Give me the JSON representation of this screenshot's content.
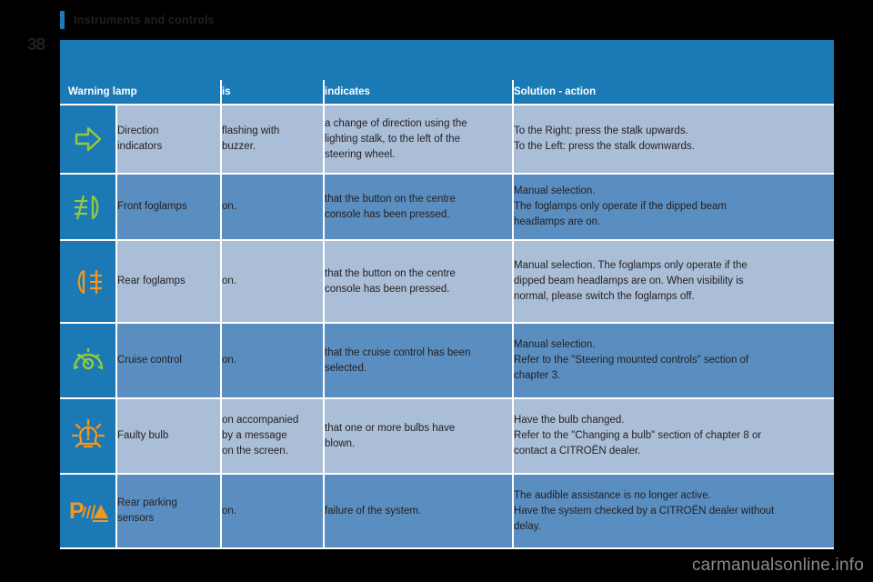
{
  "document": {
    "chapter_title": "Instruments and controls",
    "page_number": "38",
    "watermark": "carmanualsonline.info"
  },
  "colors": {
    "header_blue": "#1b7ab5",
    "row_light": "#aabed8",
    "row_dark": "#5a8dc0",
    "icon_green": "#95c93d",
    "icon_orange": "#f5961e",
    "text": "#231f20",
    "page_background": "#000000"
  },
  "table": {
    "headers": [
      "Warning lamp",
      "is",
      "indicates",
      "Solution - action"
    ],
    "rows": [
      {
        "icon": "direction-indicator-arrow-icon",
        "icon_color": "#95c93d",
        "lamp": [
          "Direction",
          "indicators"
        ],
        "is": [
          "flashing with",
          "buzzer."
        ],
        "indicates": [
          "a change of direction using the",
          "lighting stalk, to the left of the",
          "steering wheel."
        ],
        "solution": [
          "To the Right: press the stalk upwards.",
          "To the Left: press the stalk downwards."
        ],
        "shade": "light"
      },
      {
        "icon": "front-foglamp-icon",
        "icon_color": "#95c93d",
        "lamp": [
          "Front foglamps"
        ],
        "is": [
          "on."
        ],
        "indicates": [
          "that the button on the centre",
          "console has been pressed."
        ],
        "solution": [
          "Manual selection.",
          "The foglamps only operate if the dipped beam",
          "headlamps are on."
        ],
        "shade": "dark"
      },
      {
        "icon": "rear-foglamp-icon",
        "icon_color": "#f5961e",
        "lamp": [
          "Rear foglamps"
        ],
        "is": [
          "on."
        ],
        "indicates": [
          "that the button on the centre",
          "console has been pressed."
        ],
        "solution": [
          "Manual selection. The foglamps only operate if the",
          "dipped beam headlamps are on. When visibility is",
          "normal, please switch the foglamps off."
        ],
        "shade": "light"
      },
      {
        "icon": "cruise-control-icon",
        "icon_color": "#95c93d",
        "lamp": [
          "Cruise control"
        ],
        "is": [
          "on."
        ],
        "indicates": [
          "that the cruise control has been",
          "selected."
        ],
        "solution": [
          "Manual selection.",
          "Refer to the \"Steering mounted controls\" section of",
          "chapter 3."
        ],
        "shade": "dark"
      },
      {
        "icon": "faulty-bulb-icon",
        "icon_color": "#f5961e",
        "lamp": [
          "Faulty bulb"
        ],
        "is": [
          "on accompanied",
          "by a message",
          "on the screen."
        ],
        "indicates": [
          "that one or more bulbs have",
          "blown."
        ],
        "solution": [
          "Have the bulb changed.",
          "Refer to the \"Changing a bulb\" section of chapter 8 or",
          "contact a CITROËN dealer."
        ],
        "shade": "light"
      },
      {
        "icon": "rear-parking-sensors-icon",
        "icon_color": "#f5961e",
        "lamp": [
          "Rear parking",
          "sensors"
        ],
        "is": [
          "on."
        ],
        "indicates": [
          "failure of the system."
        ],
        "solution": [
          "The audible assistance is no longer active.",
          "Have the system checked by a CITROËN dealer without",
          "delay."
        ],
        "shade": "dark"
      }
    ]
  }
}
